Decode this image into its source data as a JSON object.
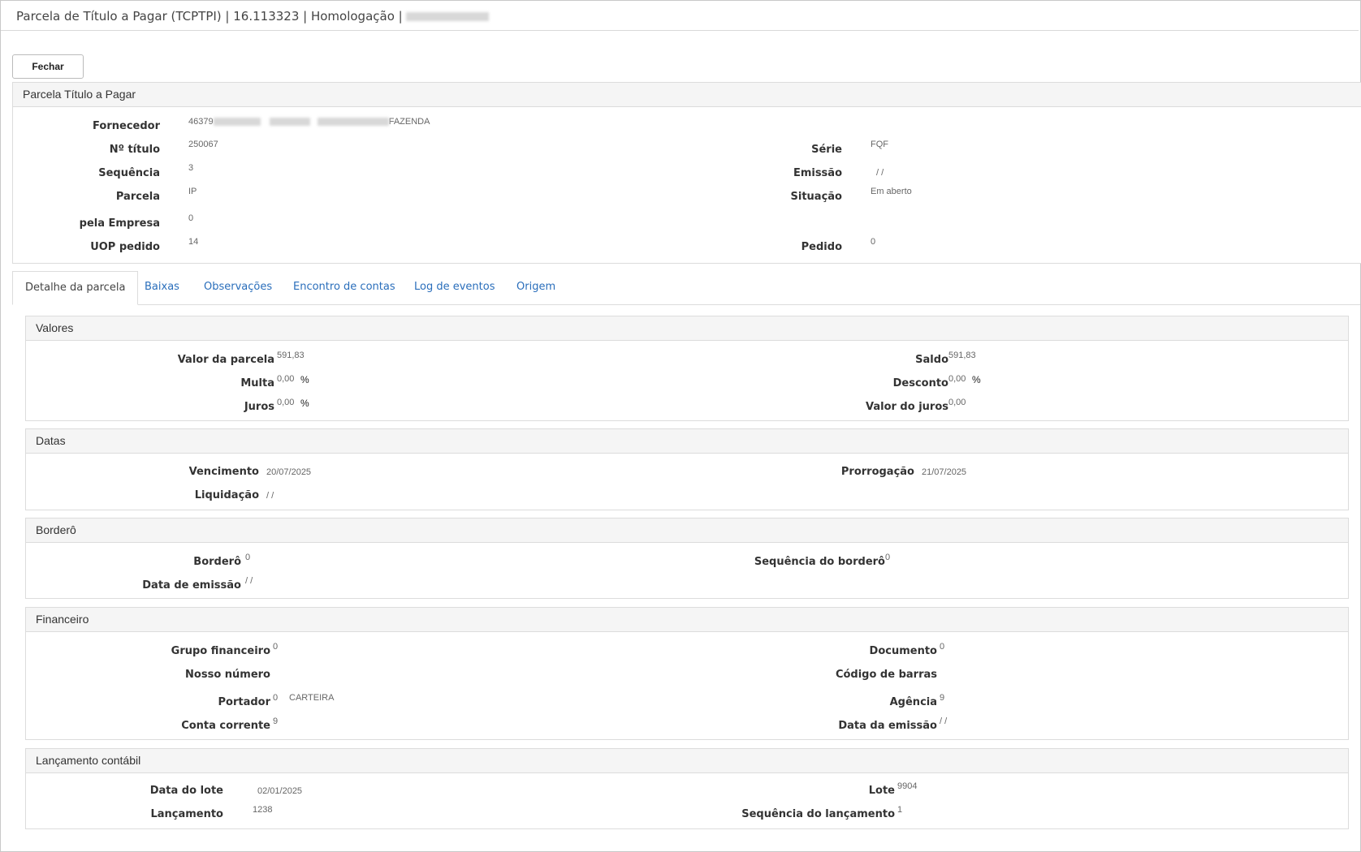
{
  "window": {
    "title": "Parcela de Título a Pagar (TCPTPI) | 16.113323 | Homologação | "
  },
  "toolbar": {
    "close_label": "Fechar"
  },
  "header_panel": {
    "title": "Parcela Título a Pagar",
    "fornecedor_label": "Fornecedor",
    "fornecedor_value_prefix": "46379",
    "fornecedor_value_suffix": "FAZENDA",
    "numero_titulo_label": "Nº título",
    "numero_titulo_value": "250067",
    "serie_label": "Série",
    "serie_value": "FQF",
    "sequencia_label": "Sequência",
    "sequencia_value": "3",
    "emissao_label": "Emissão",
    "emissao_value": "/ /",
    "parcela_label": "Parcela",
    "parcela_value": "IP",
    "situacao_label": "Situação",
    "situacao_value": "Em aberto",
    "empresa_label": "pela Empresa",
    "empresa_value": "0",
    "uop_label": "UOP pedido",
    "uop_value": "14",
    "pedido_label": "Pedido",
    "pedido_value": "0"
  },
  "tabs": [
    {
      "label": "Detalhe da parcela",
      "active": true
    },
    {
      "label": "Baixas"
    },
    {
      "label": "Observações"
    },
    {
      "label": "Encontro de contas"
    },
    {
      "label": "Log de eventos"
    },
    {
      "label": "Origem"
    }
  ],
  "valores": {
    "title": "Valores",
    "valor_parcela_label": "Valor da parcela",
    "valor_parcela_value": "591,83",
    "saldo_label": "Saldo",
    "saldo_value": "591,83",
    "multa_label": "Multa",
    "multa_value": "0,00",
    "desconto_label": "Desconto",
    "desconto_value": "0,00",
    "juros_label": "Juros",
    "juros_value": "0,00",
    "valor_juros_label": "Valor do juros",
    "valor_juros_value": "0,00",
    "percent_symbol": "%"
  },
  "datas": {
    "title": "Datas",
    "vencimento_label": "Vencimento",
    "vencimento_value": "20/07/2025",
    "prorrogacao_label": "Prorrogação",
    "prorrogacao_value": "21/07/2025",
    "liquidacao_label": "Liquidação",
    "liquidacao_value": "/ /"
  },
  "bordero": {
    "title": "Borderô",
    "bordero_label": "Borderô",
    "bordero_value": "0",
    "seq_bordero_label": "Sequência do borderô",
    "seq_bordero_value": "0",
    "data_emissao_label": "Data de emissão",
    "data_emissao_value": "/ /"
  },
  "financeiro": {
    "title": "Financeiro",
    "grupo_label": "Grupo financeiro",
    "grupo_value": "0",
    "documento_label": "Documento",
    "documento_value": "0",
    "nosso_numero_label": "Nosso número",
    "codigo_barras_label": "Código de barras",
    "portador_label": "Portador",
    "portador_value": "0",
    "portador_name": "CARTEIRA",
    "agencia_label": "Agência",
    "agencia_value": "9",
    "conta_label": "Conta corrente",
    "conta_value": "9",
    "data_emissao_label": "Data da emissão",
    "data_emissao_value": "/ /"
  },
  "lancamento": {
    "title": "Lançamento contábil",
    "data_lote_label": "Data do lote",
    "data_lote_value": "02/01/2025",
    "lote_label": "Lote",
    "lote_value": "9904",
    "lancamento_label": "Lançamento",
    "lancamento_value": "1238",
    "seq_lancamento_label": "Sequência do lançamento",
    "seq_lancamento_value": "1"
  }
}
